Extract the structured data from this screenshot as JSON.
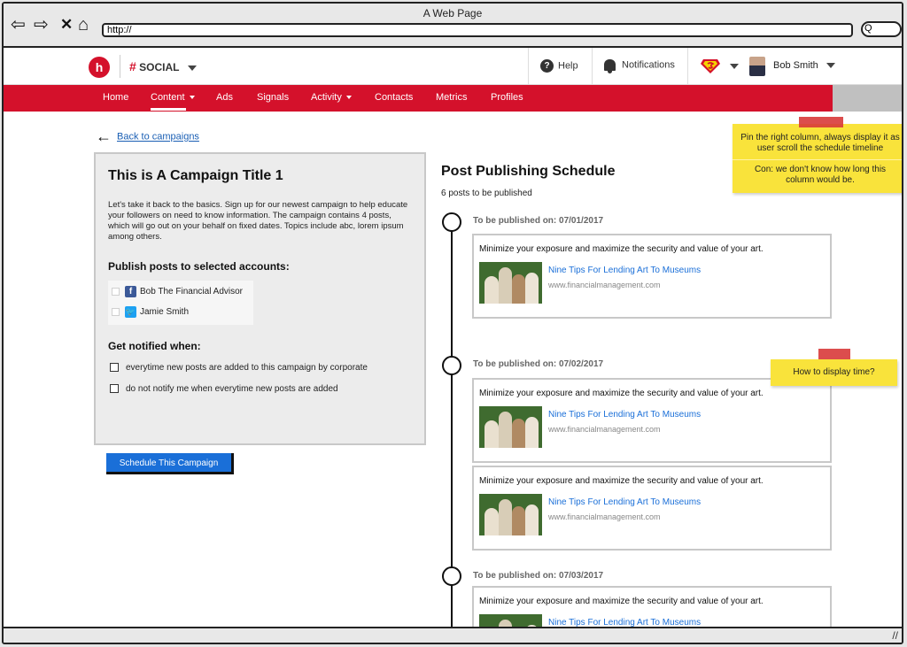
{
  "browser": {
    "title": "A Web Page",
    "url": "http://",
    "nav": {
      "back": "⇦",
      "forward": "⇨",
      "close": "✕",
      "home": "⌂"
    },
    "search_glyph": "Q"
  },
  "topbar": {
    "logo_letter": "h",
    "brand_hash": "#",
    "brand_name": "SOCIAL",
    "help_label": "Help",
    "help_glyph": "?",
    "notifications_label": "Notifications",
    "user_name": "Bob Smith"
  },
  "nav": {
    "items": [
      {
        "label": "Home"
      },
      {
        "label": "Content",
        "active": true
      },
      {
        "label": "Ads"
      },
      {
        "label": "Signals"
      },
      {
        "label": "Activity"
      },
      {
        "label": "Contacts"
      },
      {
        "label": "Metrics"
      },
      {
        "label": "Profiles"
      }
    ],
    "accent_color": "#d4112b"
  },
  "back_link": {
    "arrow": "🡐",
    "label": "Back to campaigns"
  },
  "campaign": {
    "title": "This is A Campaign Title 1",
    "description": "Let's take it back to the basics. Sign up for our newest campaign to help educate your followers on need to know information. The campaign contains 4 posts, which will go out on your behalf on fixed dates. Topics include abc, lorem ipsum among others.",
    "publish_heading": "Publish posts to selected accounts:",
    "accounts": [
      {
        "name": "Bob The Financial Advisor",
        "network": "facebook",
        "icon": "f"
      },
      {
        "name": "Jamie Smith",
        "network": "twitter",
        "icon": "t"
      }
    ],
    "notify_heading": "Get notified when:",
    "notify_options": [
      {
        "label": "everytime new posts are added to this campaign by corporate"
      },
      {
        "label": "do not notify me when everytime new posts are added"
      }
    ],
    "schedule_button": "Schedule This Campaign"
  },
  "schedule": {
    "title": "Post Publishing Schedule",
    "count_text": "6 posts to be published",
    "groups": [
      {
        "label": "To be published on: 07/01/2017"
      },
      {
        "label": "To be published on: 07/02/2017"
      },
      {
        "label": "To be published on: 07/03/2017"
      }
    ],
    "post": {
      "message": "Minimize your exposure and maximize the security and value of your art.",
      "link_title": "Nine Tips For Lending Art To Museums",
      "domain": "www.financialmanagement.com"
    }
  },
  "notes": {
    "pin_note_1": "Pin the right column, always display it as user scroll the schedule timeline",
    "pin_note_2": "Con: we don't know how long this column would be.",
    "time_note": "How to display time?"
  }
}
